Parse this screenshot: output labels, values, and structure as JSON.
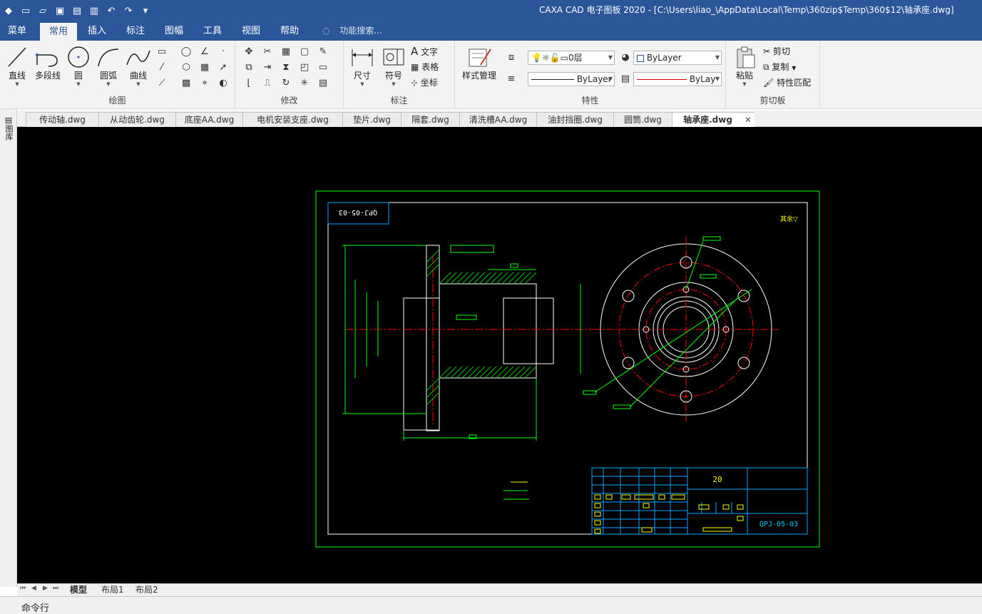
{
  "window": {
    "title": "CAXA CAD 电子图板 2020 - [C:\\Users\\liao_\\AppData\\Local\\Temp\\360zip$Temp\\360$12\\轴承座.dwg]"
  },
  "menu": {
    "tabs": [
      "菜单",
      "常用",
      "插入",
      "标注",
      "图幅",
      "工具",
      "视图",
      "帮助"
    ],
    "active": "常用",
    "search_placeholder": "功能搜索..."
  },
  "ribbon": {
    "draw": {
      "label": "绘图",
      "buttons": [
        "直线",
        "多段线",
        "圆",
        "圆弧",
        "曲线"
      ]
    },
    "modify": {
      "label": "修改"
    },
    "annotate": {
      "label": "标注",
      "buttons": [
        "尺寸",
        "符号"
      ],
      "text_buttons": [
        "文字",
        "表格",
        "坐标"
      ]
    },
    "properties": {
      "label": "特性",
      "style_button": "样式管理",
      "layer_combo": "0层",
      "color_combo": "ByLayer",
      "linetype_combo": "ByLayer",
      "lineweight_combo": "ByLay"
    },
    "clipboard": {
      "label": "剪切板",
      "paste": "粘贴",
      "items": [
        "剪切",
        "复制",
        "特性匹配"
      ]
    }
  },
  "side_panel": {
    "label": "图库"
  },
  "doc_tabs": [
    "传动轴.dwg",
    "从动齿轮.dwg",
    "底座AA.dwg",
    "电机安装支座.dwg",
    "垫片.dwg",
    "隔套.dwg",
    "清洗槽AA.dwg",
    "油封挡圈.dwg",
    "圆筒.dwg",
    "轴承座.dwg"
  ],
  "active_doc": "轴承座.dwg",
  "drawing": {
    "code_box": "QPJ-05-03",
    "title_block_number": "QPJ-05-03",
    "title_block_scale": "20"
  },
  "layout_tabs": [
    "模型",
    "布局1",
    "布局2"
  ],
  "active_layout": "模型",
  "command_line": {
    "label": "命令行"
  },
  "colors": {
    "titlebar": "#2b579a",
    "ribbon": "#f3f3f3",
    "canvas": "#000000",
    "frame_green": "#00ff00",
    "frame_white": "#ffffff",
    "center_red": "#ff0000",
    "hatch_green": "#00c000"
  }
}
